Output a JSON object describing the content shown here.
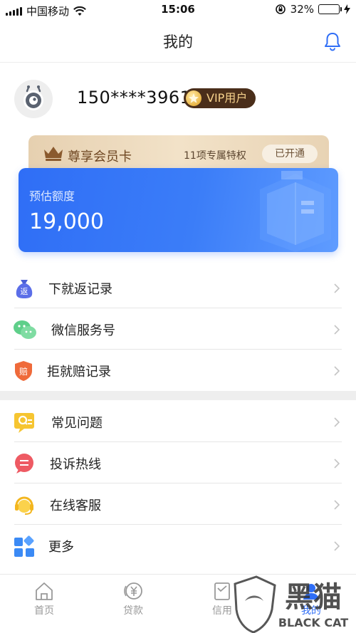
{
  "status_bar": {
    "carrier": "中国移动",
    "time": "15:06",
    "battery": "32%",
    "battery_level": 0.32
  },
  "header": {
    "title": "我的"
  },
  "profile": {
    "phone": "150****3961",
    "vip_label": "VIP用户"
  },
  "member_card": {
    "title": "尊享会员卡",
    "perks": "11项专属特权",
    "status": "已开通"
  },
  "credit": {
    "label": "预估额度",
    "value": "19,000"
  },
  "menu_group_1": [
    {
      "label": "下就返记录",
      "icon": "cashback-bag-icon",
      "icon_text": "返"
    },
    {
      "label": "微信服务号",
      "icon": "wechat-icon"
    },
    {
      "label": "拒就赔记录",
      "icon": "compensation-shield-icon",
      "icon_text": "赔"
    }
  ],
  "menu_group_2": [
    {
      "label": "常见问题",
      "icon": "faq-icon"
    },
    {
      "label": "投诉热线",
      "icon": "complaint-chat-icon"
    },
    {
      "label": "在线客服",
      "icon": "customer-service-icon"
    },
    {
      "label": "更多",
      "icon": "more-grid-icon"
    }
  ],
  "tabs": [
    {
      "label": "首页",
      "icon": "home-icon"
    },
    {
      "label": "贷款",
      "icon": "loan-yen-icon"
    },
    {
      "label": "信用",
      "icon": "credit-icon"
    },
    {
      "label": "我的",
      "icon": "profile-icon"
    }
  ],
  "watermark": {
    "text_cn": "黑猫",
    "text_en": "BLACK CAT"
  },
  "colors": {
    "accent_blue": "#2f6ef6",
    "vip_badge": "#4a2e1a",
    "member_gold": "#e6d0b0",
    "inactive_tab": "#999999"
  }
}
